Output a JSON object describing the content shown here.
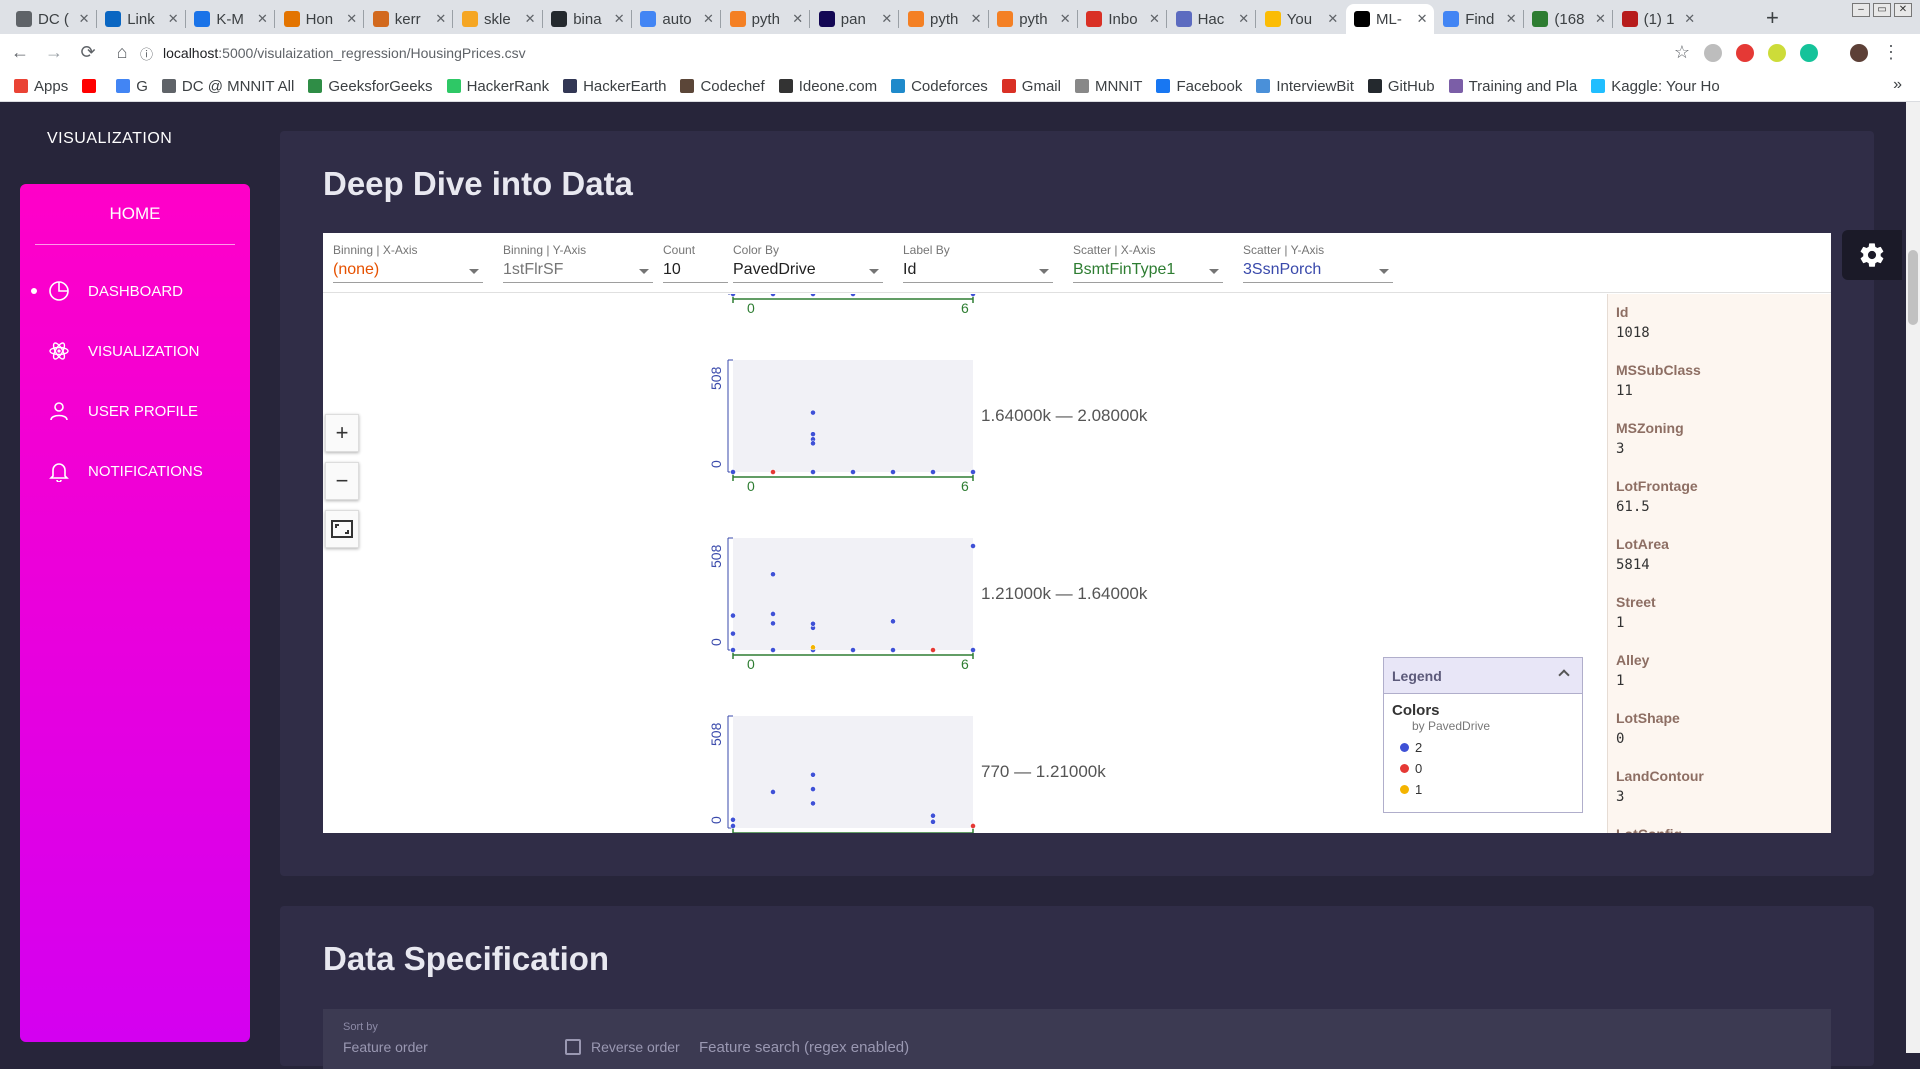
{
  "browser": {
    "tabs": [
      {
        "label": "DC (",
        "color": "#5f6368"
      },
      {
        "label": "Link",
        "color": "#0a66c2"
      },
      {
        "label": "K-M",
        "color": "#1a73e8"
      },
      {
        "label": "Hon",
        "color": "#e37400"
      },
      {
        "label": "kerr",
        "color": "#d2691e"
      },
      {
        "label": "skle",
        "color": "#f5a623"
      },
      {
        "label": "bina",
        "color": "#24292e"
      },
      {
        "label": "auto",
        "color": "#4285f4"
      },
      {
        "label": "pyth",
        "color": "#f48024"
      },
      {
        "label": "pan",
        "color": "#130754"
      },
      {
        "label": "pyth",
        "color": "#f48024"
      },
      {
        "label": "pyth",
        "color": "#f48024"
      },
      {
        "label": "Inbo",
        "color": "#d93025"
      },
      {
        "label": "Hac",
        "color": "#5c6bc0"
      },
      {
        "label": "You",
        "color": "#fbbc04"
      },
      {
        "label": "ML-",
        "color": "#000000"
      },
      {
        "label": "Find",
        "color": "#4285f4"
      },
      {
        "label": "(168",
        "color": "#2e7d32"
      },
      {
        "label": "(1) 1",
        "color": "#b71c1c"
      }
    ],
    "active_tab_index": 15,
    "close_glyph": "✕",
    "new_tab": "+",
    "url_host": "localhost",
    "url_path": ":5000/visulaization_regression/HousingPrices.csv",
    "bookmarks": [
      {
        "label": "Apps",
        "color": "#ea4335"
      },
      {
        "label": "",
        "color": "#ff0000"
      },
      {
        "label": "G",
        "color": "#4285f4"
      },
      {
        "label": "DC @ MNNIT All",
        "color": "#5f6368"
      },
      {
        "label": "GeeksforGeeks",
        "color": "#2f8d46"
      },
      {
        "label": "HackerRank",
        "color": "#2ec866"
      },
      {
        "label": "HackerEarth",
        "color": "#323754"
      },
      {
        "label": "Codechef",
        "color": "#5b4638"
      },
      {
        "label": "Ideone.com",
        "color": "#333333"
      },
      {
        "label": "Codeforces",
        "color": "#1f8acb"
      },
      {
        "label": "Gmail",
        "color": "#d93025"
      },
      {
        "label": "MNNIT",
        "color": "#888888"
      },
      {
        "label": "Facebook",
        "color": "#1877f2"
      },
      {
        "label": "InterviewBit",
        "color": "#4a90d9"
      },
      {
        "label": "GitHub",
        "color": "#24292e"
      },
      {
        "label": "Training and Pla",
        "color": "#7b5ea7"
      },
      {
        "label": "Kaggle: Your Ho",
        "color": "#20beff"
      }
    ],
    "more_bookmarks": "»"
  },
  "app": {
    "brand": "VISUALIZATION",
    "home": "HOME",
    "nav": [
      {
        "label": "DASHBOARD",
        "icon": "pie-chart-icon",
        "active": true
      },
      {
        "label": "VISUALIZATION",
        "icon": "atom-icon",
        "active": false
      },
      {
        "label": "USER PROFILE",
        "icon": "user-icon",
        "active": false
      },
      {
        "label": "NOTIFICATIONS",
        "icon": "bell-icon",
        "active": false
      }
    ],
    "section1_title": "Deep Dive into Data",
    "section2_title": "Data Specification"
  },
  "facets": {
    "controls": [
      {
        "label": "Binning | X-Axis",
        "value": "(none)",
        "color": "#e65100"
      },
      {
        "label": "Binning | Y-Axis",
        "value": "1stFlrSF",
        "color": "#757575"
      },
      {
        "label": "Count",
        "value": "10",
        "color": "#212121"
      },
      {
        "label": "Color By",
        "value": "PavedDrive",
        "color": "#212121"
      },
      {
        "label": "Label By",
        "value": "Id",
        "color": "#212121"
      },
      {
        "label": "Scatter | X-Axis",
        "value": "BsmtFinType1",
        "color": "#2e7d32"
      },
      {
        "label": "Scatter | Y-Axis",
        "value": "3SsnPorch",
        "color": "#3949ab"
      }
    ],
    "zoom_in": "+",
    "zoom_out": "−",
    "legend": {
      "title": "Legend",
      "colors_title": "Colors",
      "colors_sub": "by PavedDrive",
      "items": [
        {
          "label": "2",
          "color": "#3f51d6"
        },
        {
          "label": "0",
          "color": "#e53935"
        },
        {
          "label": "1",
          "color": "#f4b400"
        }
      ]
    },
    "info": [
      {
        "key": "Id",
        "value": "1018"
      },
      {
        "key": "MSSubClass",
        "value": "11"
      },
      {
        "key": "MSZoning",
        "value": "3"
      },
      {
        "key": "LotFrontage",
        "value": "61.5"
      },
      {
        "key": "LotArea",
        "value": "5814"
      },
      {
        "key": "Street",
        "value": "1"
      },
      {
        "key": "Alley",
        "value": "1"
      },
      {
        "key": "LotShape",
        "value": "0"
      },
      {
        "key": "LandContour",
        "value": "3"
      },
      {
        "key": "LotConfig",
        "value": ""
      }
    ]
  },
  "spec": {
    "sort_label": "Sort by",
    "sort_value": "Feature order",
    "reverse_label": "Reverse order",
    "search_placeholder": "Feature search (regex enabled)"
  },
  "chart_data": {
    "type": "scatter",
    "x_axis_ticks": [
      "0",
      "6"
    ],
    "y_axis_ticks": [
      "0",
      "508"
    ],
    "x_range": [
      0,
      6
    ],
    "y_range": [
      0,
      508
    ],
    "colors": {
      "2": "#3f51d6",
      "0": "#e53935",
      "1": "#f4b400"
    },
    "facets": [
      {
        "label": "",
        "points": [
          {
            "x": 0,
            "y": 0,
            "c": "2"
          },
          {
            "x": 1,
            "y": 0,
            "c": "2"
          },
          {
            "x": 2,
            "y": 0,
            "c": "2"
          },
          {
            "x": 3,
            "y": 0,
            "c": "2"
          },
          {
            "x": 6,
            "y": 0,
            "c": "2"
          }
        ]
      },
      {
        "label": "1.64000k — 2.08000k",
        "points": [
          {
            "x": 0,
            "y": 0,
            "c": "2"
          },
          {
            "x": 1,
            "y": 0,
            "c": "0"
          },
          {
            "x": 2,
            "y": 0,
            "c": "2"
          },
          {
            "x": 2,
            "y": 290,
            "c": "2"
          },
          {
            "x": 2,
            "y": 160,
            "c": "2"
          },
          {
            "x": 2,
            "y": 140,
            "c": "2"
          },
          {
            "x": 2,
            "y": 185,
            "c": "2"
          },
          {
            "x": 3,
            "y": 0,
            "c": "2"
          },
          {
            "x": 4,
            "y": 0,
            "c": "2"
          },
          {
            "x": 5,
            "y": 0,
            "c": "2"
          },
          {
            "x": 6,
            "y": 0,
            "c": "2"
          }
        ]
      },
      {
        "label": "1.21000k — 1.64000k",
        "points": [
          {
            "x": 0,
            "y": 0,
            "c": "2"
          },
          {
            "x": 0,
            "y": 168,
            "c": "2"
          },
          {
            "x": 0,
            "y": 80,
            "c": "2"
          },
          {
            "x": 1,
            "y": 0,
            "c": "2"
          },
          {
            "x": 1,
            "y": 370,
            "c": "2"
          },
          {
            "x": 1,
            "y": 176,
            "c": "2"
          },
          {
            "x": 1,
            "y": 130,
            "c": "2"
          },
          {
            "x": 2,
            "y": 0,
            "c": "2"
          },
          {
            "x": 2,
            "y": 13,
            "c": "1"
          },
          {
            "x": 2,
            "y": 108,
            "c": "2"
          },
          {
            "x": 2,
            "y": 128,
            "c": "2"
          },
          {
            "x": 3,
            "y": 0,
            "c": "2"
          },
          {
            "x": 4,
            "y": 0,
            "c": "2"
          },
          {
            "x": 4,
            "y": 140,
            "c": "2"
          },
          {
            "x": 5,
            "y": 0,
            "c": "0"
          },
          {
            "x": 6,
            "y": 0,
            "c": "2"
          },
          {
            "x": 6,
            "y": 508,
            "c": "2"
          }
        ]
      },
      {
        "label": "770 — 1.21000k",
        "points": [
          {
            "x": 0,
            "y": 40,
            "c": "2"
          },
          {
            "x": 0,
            "y": 10,
            "c": "2"
          },
          {
            "x": 1,
            "y": 176,
            "c": "2"
          },
          {
            "x": 2,
            "y": 260,
            "c": "2"
          },
          {
            "x": 2,
            "y": 190,
            "c": "2"
          },
          {
            "x": 2,
            "y": 120,
            "c": "2"
          },
          {
            "x": 5,
            "y": 60,
            "c": "2"
          },
          {
            "x": 5,
            "y": 30,
            "c": "2"
          },
          {
            "x": 6,
            "y": 10,
            "c": "0"
          }
        ]
      }
    ]
  }
}
